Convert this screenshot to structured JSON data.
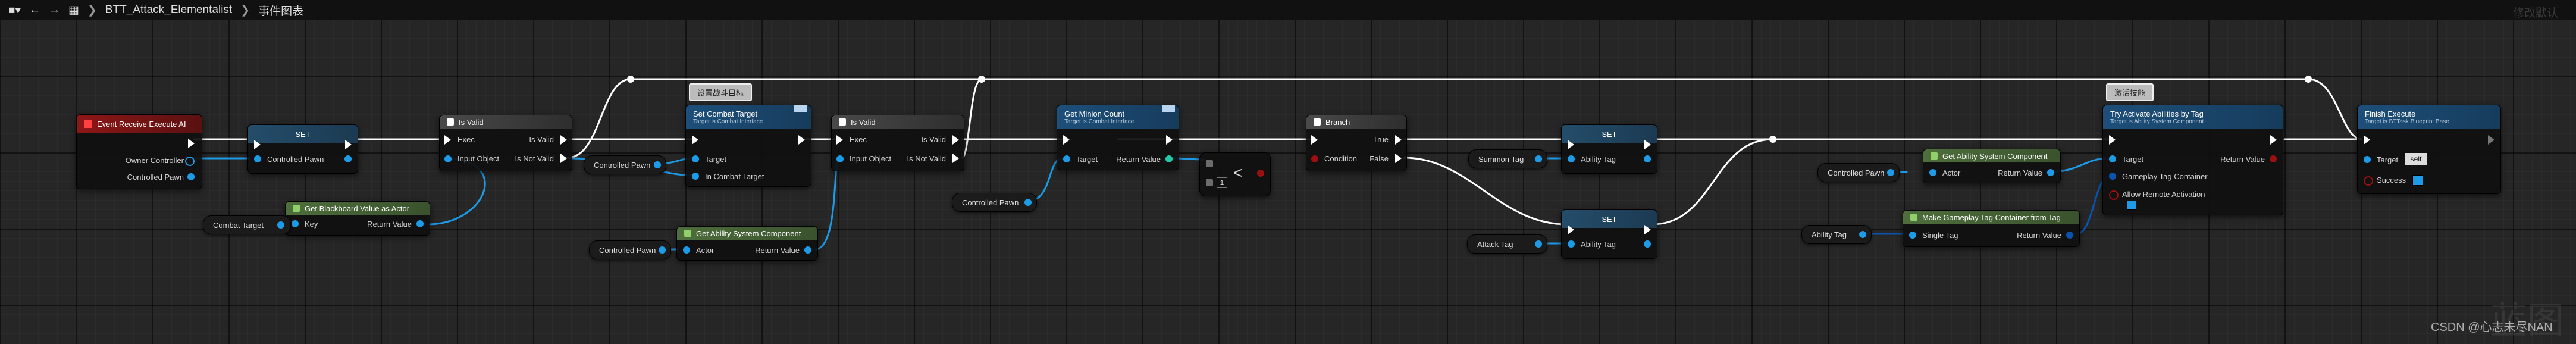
{
  "toolbar": {
    "path_separator": "❯",
    "blueprint_name": "BTT_Attack_Elementalist",
    "graph_name": "事件图表",
    "top_right": "修改默认"
  },
  "comments": {
    "is_valid_comment": "设置战斗目标",
    "activate_comment": "激活技能"
  },
  "nodes": {
    "event": {
      "title": "Event Receive Execute AI",
      "owner_controller": "Owner Controller",
      "controlled_pawn": "Controlled Pawn"
    },
    "set_pawn": {
      "title": "SET",
      "controlled_pawn": "Controlled Pawn"
    },
    "get_bb": {
      "title": "Get Blackboard Value as Actor",
      "key": "Key",
      "return_value": "Return Value"
    },
    "combat_target_var": "Combat Target",
    "is_valid_1": {
      "title": "Is Valid",
      "exec": "Exec",
      "input_object": "Input Object",
      "is_valid": "Is Valid",
      "is_not_valid": "Is Not Valid"
    },
    "controlled_pawn_var_1": "Controlled Pawn",
    "set_combat_target": {
      "title": "Set Combat Target",
      "subtitle": "Target is Combat Interface",
      "target": "Target",
      "in_combat_target": "In Combat Target"
    },
    "get_asc_1": {
      "title": "Get Ability System Component",
      "actor": "Actor",
      "return_value": "Return Value"
    },
    "controlled_pawn_var_2": "Controlled Pawn",
    "is_valid_2": {
      "title": "Is Valid",
      "exec": "Exec",
      "input_object": "Input Object",
      "is_valid": "Is Valid",
      "is_not_valid": "Is Not Valid"
    },
    "get_minion_count": {
      "title": "Get Minion Count",
      "subtitle": "Target is Combat Interface",
      "target": "Target",
      "return_value": "Return Value"
    },
    "controlled_pawn_var_3": "Controlled Pawn",
    "less_node": {
      "symbol": "<",
      "value": "1"
    },
    "branch": {
      "title": "Branch",
      "condition": "Condition",
      "true": "True",
      "false": "False"
    },
    "summon_tag_var": "Summon Tag",
    "attack_tag_var": "Attack Tag",
    "set_ability_tag_1": {
      "title": "SET",
      "ability_tag": "Ability Tag"
    },
    "set_ability_tag_2": {
      "title": "SET",
      "ability_tag": "Ability Tag"
    },
    "controlled_pawn_var_4": "Controlled Pawn",
    "get_asc_2": {
      "title": "Get Ability System Component",
      "actor": "Actor",
      "return_value": "Return Value"
    },
    "ability_tag_var": "Ability Tag",
    "make_tag_container": {
      "title": "Make Gameplay Tag Container from Tag",
      "single_tag": "Single Tag",
      "return_value": "Return Value"
    },
    "try_activate": {
      "title": "Try Activate Abilities by Tag",
      "subtitle": "Target is Ability System Component",
      "target": "Target",
      "gameplay_tag_container": "Gameplay Tag Container",
      "allow_remote_activation": "Allow Remote Activation",
      "return_value": "Return Value"
    },
    "finish_execute": {
      "title": "Finish Execute",
      "subtitle": "Target is BTTask Blueprint Base",
      "target": "Target",
      "self_value": "self",
      "success": "Success"
    }
  },
  "watermark": {
    "logo": "蓝图",
    "credit": "CSDN @心志未尽NAN"
  },
  "colors": {
    "exec_wire": "#ffffff",
    "object_wire": "#1e9be6",
    "struct_wire": "#0a54b0",
    "bool_pin": "#9a1010",
    "event_header": "#8e1616",
    "function_header": "#1d4f7a",
    "pure_header": "#4e6e3c",
    "set_header": "#244d6a"
  }
}
